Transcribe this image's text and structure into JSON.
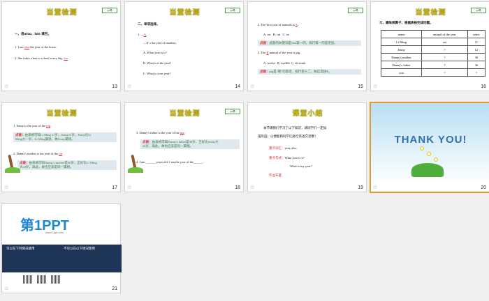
{
  "slides": [
    {
      "num": "13",
      "title": "当堂检测",
      "tag": "示练",
      "lines": [
        "一、用also、too 填空。",
        "1. I am ",
        "also",
        " the year of the horse.",
        "2. She takes a bus to school every day, ",
        "too",
        "."
      ]
    },
    {
      "num": "14",
      "title": "当堂检测",
      "tag": "示练",
      "lines": [
        "二、单项选择。",
        "1. —",
        "A",
        "",
        "—It' s the year of monkey.",
        "A. What year is it?",
        "B. What is it the year?",
        "C. What is your year?"
      ]
    },
    {
      "num": "15",
      "title": "",
      "tag": "示练",
      "lines": [
        "2. The first year of animals is ",
        "A",
        ".",
        "A. rat",
        "B. cat",
        "C. ox",
        "点拨：",
        "此题的关键词是first第一的，排行第一的是老鼠。",
        "3. The ",
        "B",
        " animal of the year is pig.",
        "A. twelve",
        "B. twelfth",
        "C. eleventh",
        "点拨：",
        "pig是“猪”的意思，排行第十二，故应选择B。"
      ]
    },
    {
      "num": "16",
      "title": "当堂检测",
      "tag": "示练",
      "heading": "三、趣味择算子，根据表格完成问题。",
      "table": {
        "headers": [
          "name",
          "animal of the year",
          "years"
        ],
        "rows": [
          [
            "Li Ming",
            "rat",
            "11"
          ],
          [
            "Jenny",
            "?",
            "12"
          ],
          [
            "Danny's mother",
            "?",
            "30"
          ],
          [
            "Danny's father",
            "?",
            "36"
          ],
          [
            "you",
            "?",
            "?"
          ]
        ]
      }
    },
    {
      "num": "17",
      "title": "当堂检测",
      "tag": "",
      "lines": [
        "1. Jenny is the year of the ",
        "pig",
        ".",
        "点拨：",
        "由表格可知Li Ming 11岁，Jenny12岁，Jenny比Li",
        "Ming大一岁，Li Ming属鼠，故Jenny属猪。",
        "2. Danny's mother is the year of the ",
        "rat",
        ".",
        "点拨：",
        "由表格可知Danny's mother是30岁，正好比Li Ming",
        "大24岁，再此，故也应该是同一属相。"
      ]
    },
    {
      "num": "18",
      "title": "当堂检测",
      "tag": "示练",
      "lines": [
        "3. Danny's father is the year of the ",
        "pig",
        ".",
        "点拨：",
        "由表格可知Danny's father是36岁，正好比Jenny大",
        "24岁，再此，故也应该是同一属相。",
        "4. I am ______ years old. I am the year of the______."
      ]
    },
    {
      "num": "19",
      "title": "课堂小结",
      "tag": "",
      "lines": [
        "本节课我们学习了以下知识，请同学们一定加",
        "强巩固，以便能和同学们进行英语交流哦！",
        "重点词汇：",
        "year, also",
        "重点句式：",
        "What year is it?",
        "What is my year?",
        "作业布置"
      ]
    },
    {
      "num": "20",
      "title": "THANK YOU!",
      "tag": ""
    },
    {
      "num": "21",
      "title": "第1PPT",
      "tag": "",
      "lines": [
        "www.1ppt.com",
        "可以在下列情况使用",
        "不可以在以下情况使用"
      ]
    }
  ]
}
